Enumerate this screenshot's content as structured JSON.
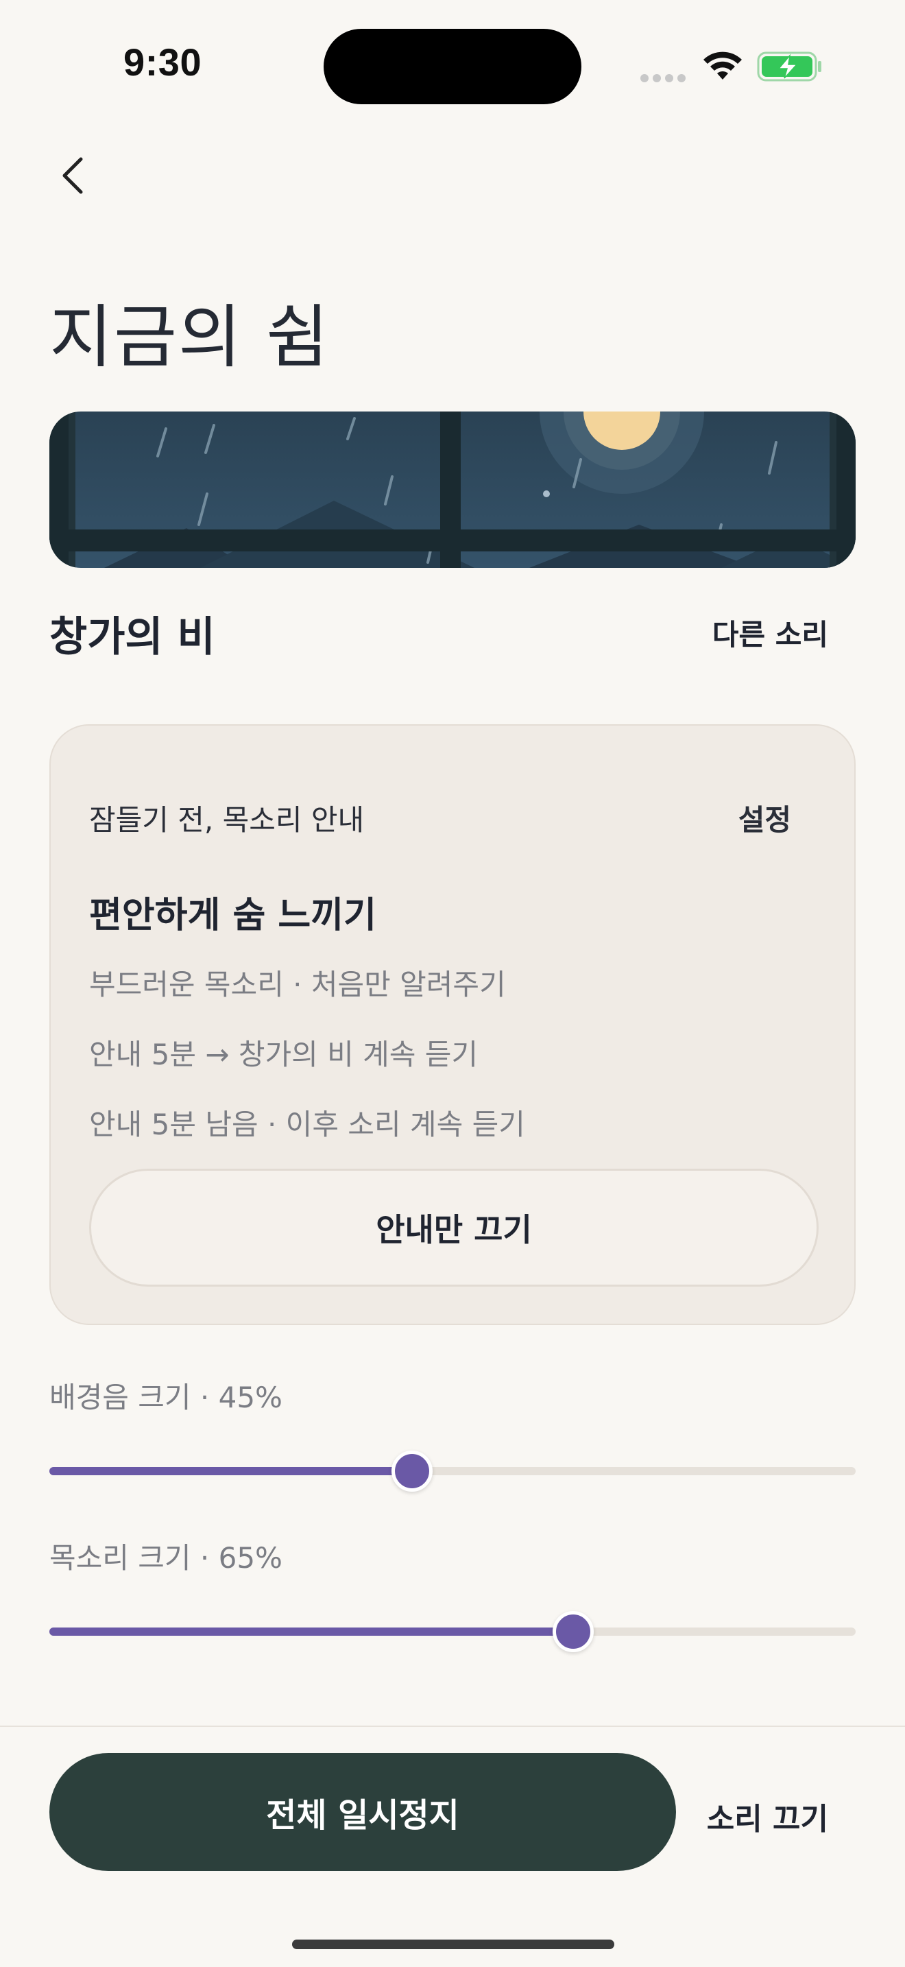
{
  "status_bar": {
    "time": "9:30",
    "battery_color": "#34c759"
  },
  "header": {
    "title": "지금의 쉼",
    "back_icon": "chevron-left-icon"
  },
  "banner": {
    "scene": "rainy window at night with moon",
    "colors": {
      "sky": "#2e4a5e",
      "frame": "#1a2a30",
      "moon": "#f3d49a"
    }
  },
  "sound": {
    "title": "창가의 비",
    "other_label": "다른 소리"
  },
  "guide": {
    "heading": "잠들기 전, 목소리 안내",
    "settings_label": "설정",
    "program": "편안하게 숨 느끼기",
    "lines": [
      "부드러운 목소리 · 처음만 알려주기",
      "안내 5분 → 창가의 비 계속 듣기",
      "안내 5분 남음 · 이후 소리 계속 듣기"
    ],
    "off_button": "안내만 끄기"
  },
  "sliders": {
    "background": {
      "label": "배경음 크기 · 45%",
      "value": 0.45
    },
    "voice": {
      "label": "목소리 크기 · 65%",
      "value": 0.65
    },
    "accent_color": "#6a59a6"
  },
  "bottom": {
    "pause_all": "전체 일시정지",
    "mute": "소리 끄기",
    "button_color": "#2c403c"
  }
}
